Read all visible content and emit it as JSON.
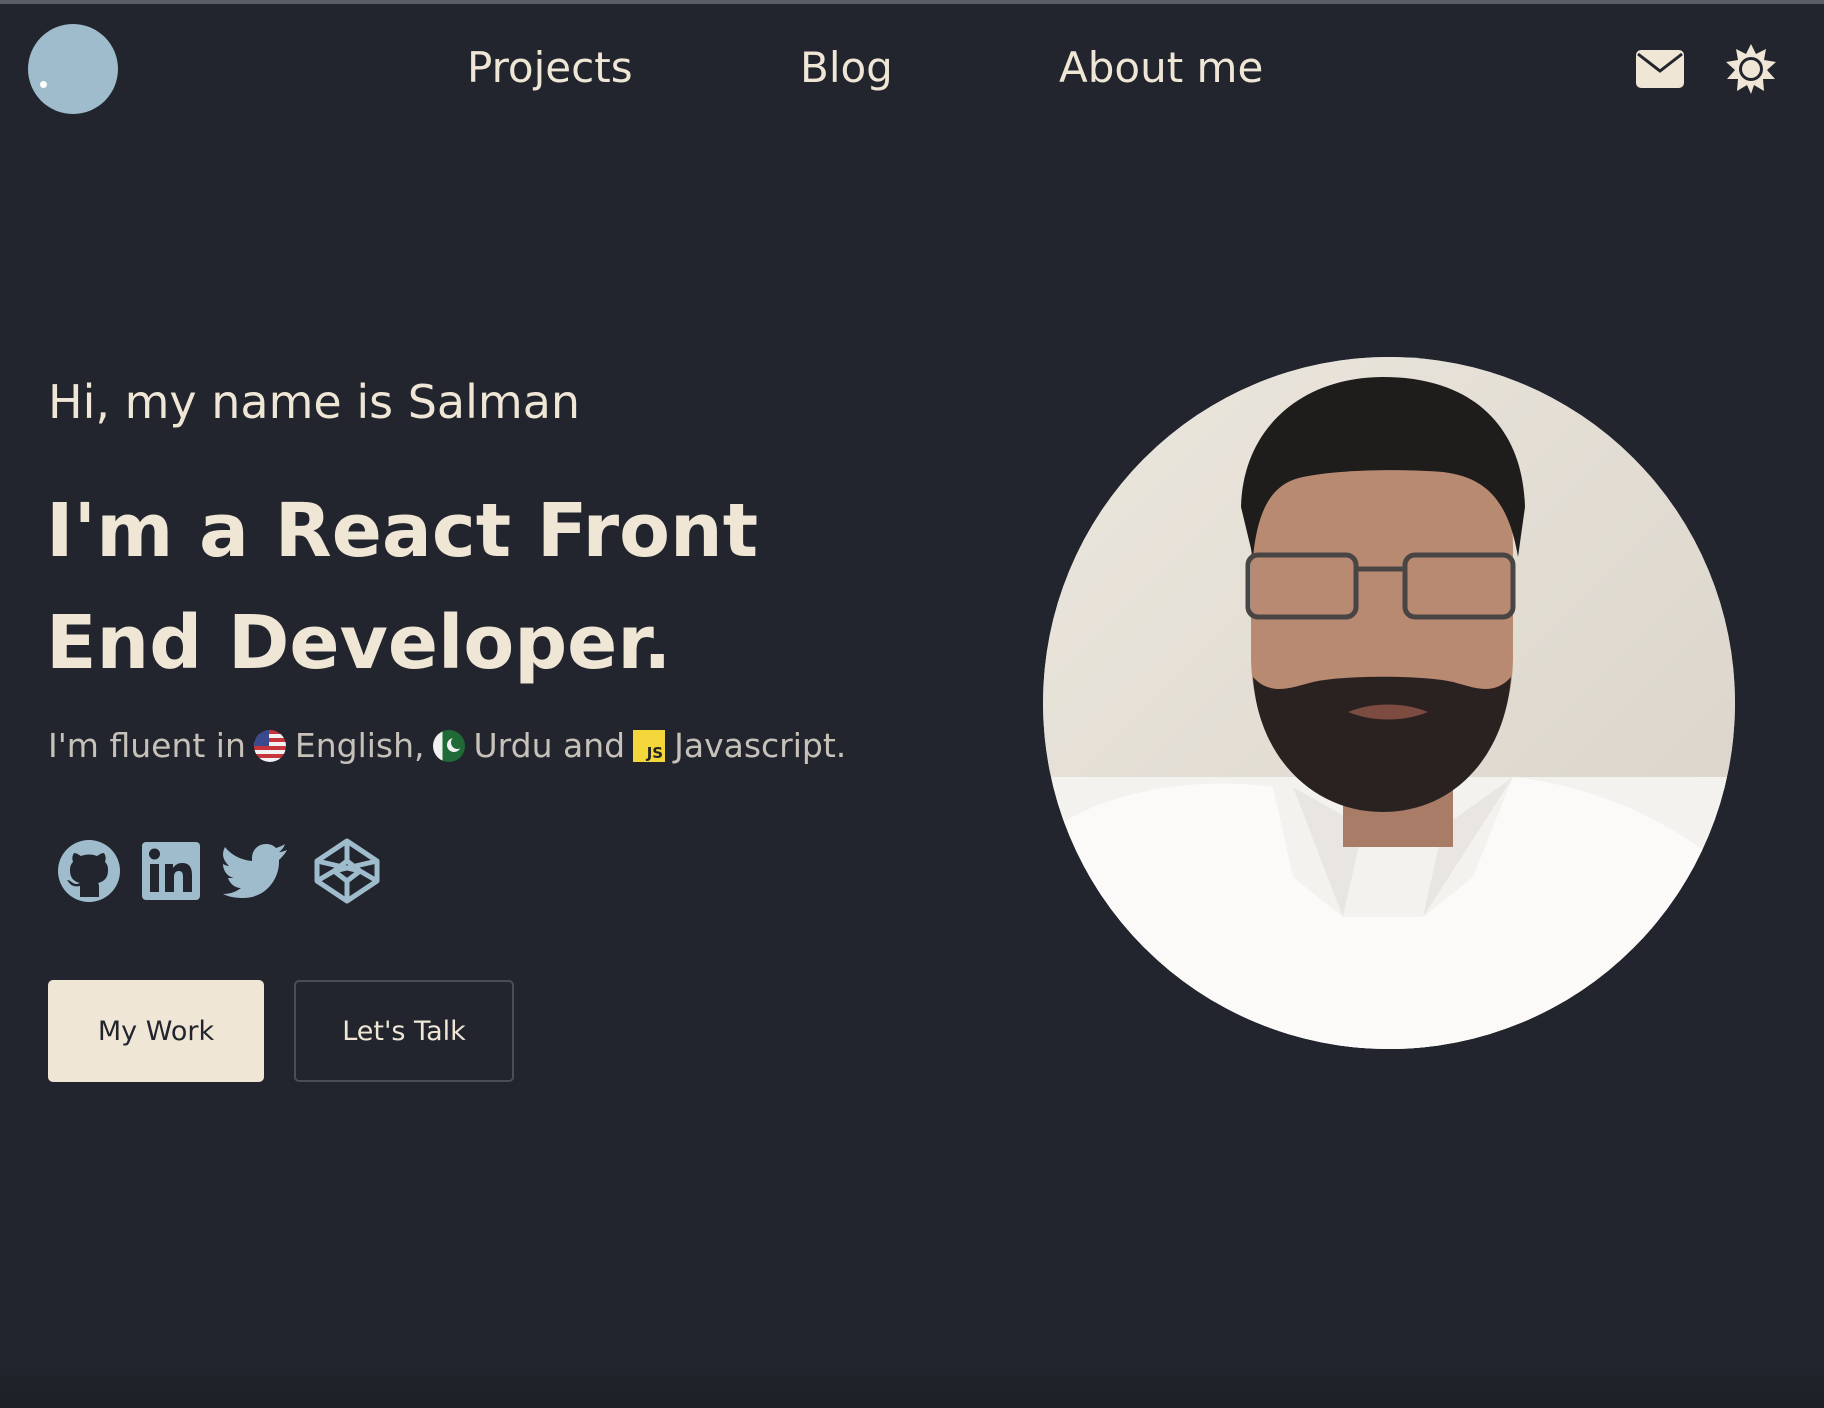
{
  "nav": {
    "projects": "Projects",
    "blog": "Blog",
    "about": "About me"
  },
  "header_icons": [
    "mail-icon",
    "sun-icon"
  ],
  "hero": {
    "greeting": "Hi, my name is Salman",
    "headline": "I'm a React Front End Developer.",
    "fluent_prefix": "I'm fluent in",
    "lang1": "English,",
    "lang2": "Urdu and",
    "js_badge": "JS",
    "lang3": "Javascript."
  },
  "social_icons": [
    "github-icon",
    "linkedin-icon",
    "twitter-icon",
    "codepen-icon"
  ],
  "buttons": {
    "work": "My Work",
    "talk": "Let's Talk"
  },
  "colors": {
    "background": "#22252d",
    "text": "#efe6d6",
    "accent": "#9fbccc"
  }
}
